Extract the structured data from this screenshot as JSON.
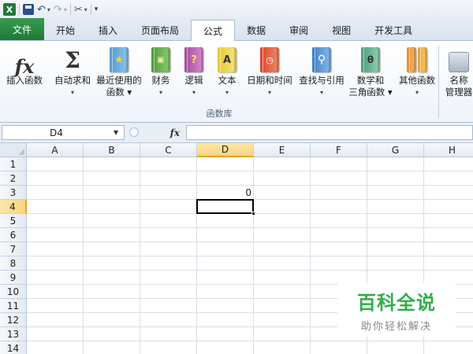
{
  "app": {
    "accent_green": "#1e7a36",
    "selection_color": "#f9d57d"
  },
  "qat": {
    "excel_logo_text": "X"
  },
  "tabs": [
    {
      "label": "文件",
      "icon": ""
    },
    {
      "label": "开始"
    },
    {
      "label": "插入"
    },
    {
      "label": "页面布局"
    },
    {
      "label": "公式"
    },
    {
      "label": "数据"
    },
    {
      "label": "审阅"
    },
    {
      "label": "视图"
    },
    {
      "label": "开发工具"
    }
  ],
  "ribbon": {
    "group_label": "函数库",
    "buttons": [
      {
        "line1": "插入函数",
        "line2": "",
        "icon": "fx-icon"
      },
      {
        "line1": "自动求和",
        "line2": "▾",
        "icon": "sigma-icon"
      },
      {
        "line1": "最近使用的",
        "line2": "函数 ▾",
        "icon": "star-book-icon"
      },
      {
        "line1": "财务",
        "line2": "▾",
        "icon": "money-book-icon"
      },
      {
        "line1": "逻辑",
        "line2": "▾",
        "icon": "question-book-icon"
      },
      {
        "line1": "文本",
        "line2": "▾",
        "icon": "text-book-icon"
      },
      {
        "line1": "日期和时间",
        "line2": "▾",
        "icon": "clock-book-icon"
      },
      {
        "line1": "查找与引用",
        "line2": "▾",
        "icon": "magnifier-book-icon"
      },
      {
        "line1": "数学和",
        "line2": "三角函数 ▾",
        "icon": "theta-book-icon"
      },
      {
        "line1": "其他函数",
        "line2": "▾",
        "icon": "books-icon"
      },
      {
        "line1": "名称",
        "line2": "管理器",
        "icon": "name-manager-icon"
      }
    ],
    "book_glyphs": {
      "logical": "?",
      "text": "A",
      "math": "θ"
    }
  },
  "formula_bar": {
    "name_box": "D4",
    "fx_label": "fx",
    "formula": ""
  },
  "grid": {
    "columns": [
      "A",
      "B",
      "C",
      "D",
      "E",
      "F",
      "G",
      "H"
    ],
    "rows": [
      "1",
      "2",
      "3",
      "4",
      "5",
      "6",
      "7",
      "8",
      "9",
      "10",
      "11",
      "12",
      "13",
      "14"
    ],
    "selected_column": "D",
    "selected_row": "4",
    "cells": {
      "D3": "0"
    }
  },
  "watermark": {
    "main": "百科全说",
    "sub": "助你轻松解决"
  }
}
